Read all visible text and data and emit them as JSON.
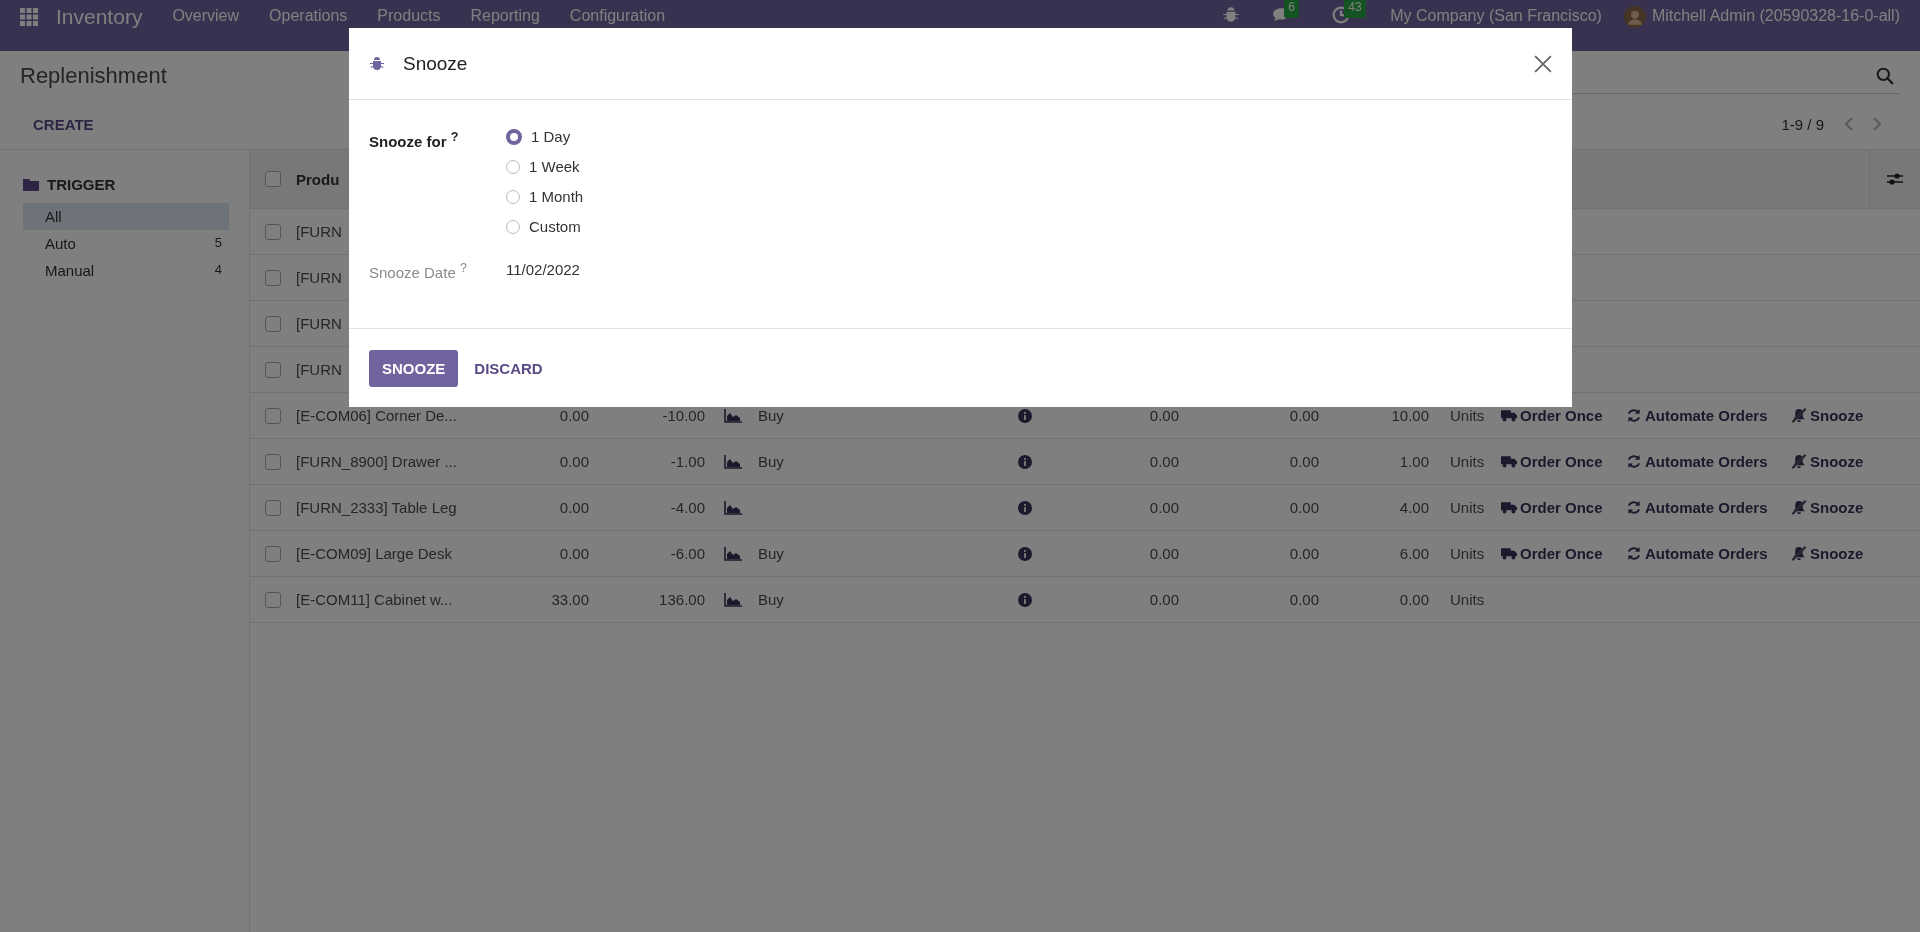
{
  "navbar": {
    "app_name": "Inventory",
    "menu": [
      "Overview",
      "Operations",
      "Products",
      "Reporting",
      "Configuration"
    ],
    "messages_count": "6",
    "activities_count": "43",
    "company": "My Company (San Francisco)",
    "user": "Mitchell Admin (20590328-16-0-all)"
  },
  "control_panel": {
    "title": "Replenishment",
    "create_button": "CREATE",
    "pager": "1-9 / 9"
  },
  "sidebar": {
    "heading": "TRIGGER",
    "items": [
      {
        "label": "All",
        "selected": true
      },
      {
        "label": "Auto",
        "count": "5",
        "selected": false
      },
      {
        "label": "Manual",
        "count": "4",
        "selected": false
      }
    ]
  },
  "table": {
    "first_column": "Produ",
    "all_checked": false,
    "rows": [
      {
        "kind": "covered",
        "checked": false,
        "product": "[FURN"
      },
      {
        "kind": "covered",
        "checked": false,
        "product": "[FURN"
      },
      {
        "kind": "covered",
        "checked": false,
        "product": "[FURN"
      },
      {
        "kind": "covered",
        "checked": false,
        "product": "[FURN"
      },
      {
        "kind": "full",
        "checked": false,
        "product": "[E-COM06] Corner De...",
        "on_hand": "0.00",
        "forecast": "-10.00",
        "route": "Buy",
        "min": "0.00",
        "max": "0.00",
        "to_order": "10.00",
        "uom": "Units",
        "actions": [
          "Order Once",
          "Automate Orders",
          "Snooze"
        ]
      },
      {
        "kind": "full",
        "checked": false,
        "product": "[FURN_8900] Drawer ...",
        "on_hand": "0.00",
        "forecast": "-1.00",
        "route": "Buy",
        "min": "0.00",
        "max": "0.00",
        "to_order": "1.00",
        "uom": "Units",
        "actions": [
          "Order Once",
          "Automate Orders",
          "Snooze"
        ]
      },
      {
        "kind": "full",
        "checked": false,
        "product": "[FURN_2333] Table Leg",
        "on_hand": "0.00",
        "forecast": "-4.00",
        "min": "0.00",
        "max": "0.00",
        "to_order": "4.00",
        "uom": "Units",
        "actions": [
          "Order Once",
          "Automate Orders",
          "Snooze"
        ]
      },
      {
        "kind": "full",
        "checked": false,
        "product": "[E-COM09] Large Desk",
        "on_hand": "0.00",
        "forecast": "-6.00",
        "route": "Buy",
        "min": "0.00",
        "max": "0.00",
        "to_order": "6.00",
        "uom": "Units",
        "actions": [
          "Order Once",
          "Automate Orders",
          "Snooze"
        ]
      },
      {
        "kind": "full",
        "checked": false,
        "product": "[E-COM11] Cabinet w...",
        "on_hand": "33.00",
        "forecast": "136.00",
        "route": "Buy",
        "min": "0.00",
        "max": "0.00",
        "to_order": "0.00",
        "uom": "Units"
      }
    ]
  },
  "dialog": {
    "title": "Snooze",
    "snooze_for_label": "Snooze for $^{?}$",
    "options": [
      {
        "label": "1 Day",
        "selected": true
      },
      {
        "label": "1 Week",
        "selected": false
      },
      {
        "label": "1 Month",
        "selected": false
      },
      {
        "label": "Custom",
        "selected": false
      }
    ],
    "date_label": "Snooze Date $^{?}$",
    "date_value": "11/02/2022",
    "primary_button": "SNOOZE",
    "secondary_button": "DISCARD"
  }
}
